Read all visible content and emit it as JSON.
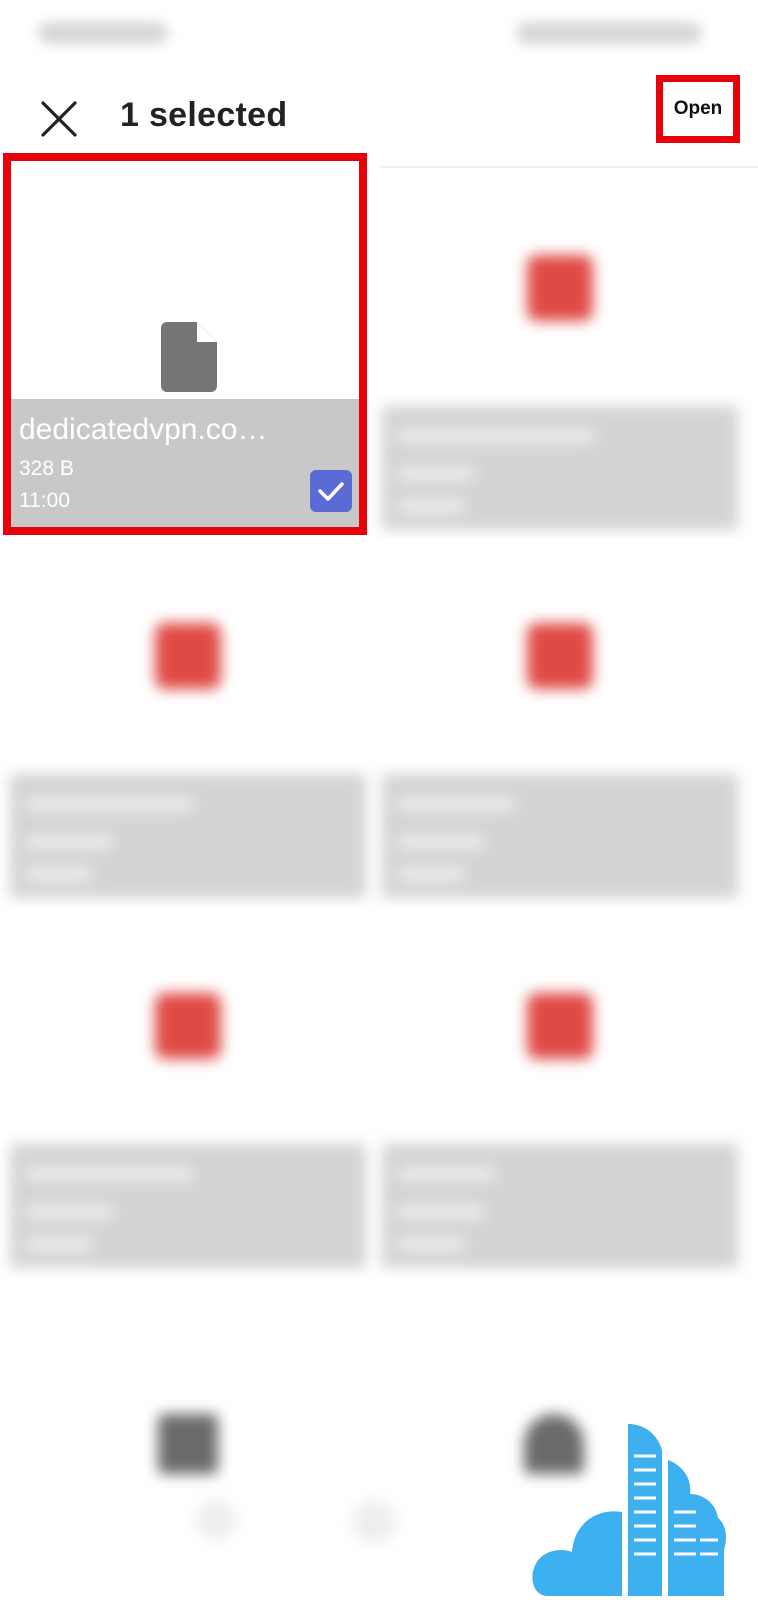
{
  "header": {
    "close_icon": "close-icon",
    "title": "1 selected",
    "open_label": "Open"
  },
  "selected_file": {
    "name": "dedicatedvpn.co…",
    "size": "328 B",
    "time": "11:00",
    "icon": "document-icon",
    "checked": true
  },
  "colors": {
    "highlight": "#e8000b",
    "checkbox": "#5b6bd5",
    "pdf_icon": "#e04a45",
    "caption_bg": "#d3d3d3",
    "watermark": "#3db0f0"
  }
}
